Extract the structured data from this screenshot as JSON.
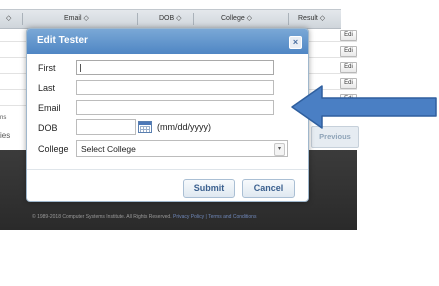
{
  "table": {
    "headers": [
      "◇",
      "Email ◇",
      "DOB ◇",
      "College ◇",
      "Result ◇"
    ],
    "edit_label": "Edi"
  },
  "side_fragments": [
    "ies",
    "ns"
  ],
  "pagination": {
    "previous_label": "Previous"
  },
  "footer": {
    "copyright": "© 1989-2018 Computer Systems Institute. All Rights Reserved.",
    "privacy": "Privacy Policy",
    "sep": " | ",
    "terms": "Terms and Conditions"
  },
  "modal": {
    "title": "Edit Tester",
    "close_symbol": "×",
    "fields": {
      "first_label": "First",
      "last_label": "Last",
      "email_label": "Email",
      "dob_label": "DOB",
      "dob_hint": "(mm/dd/yyyy)",
      "college_label": "College",
      "college_selected": "Select College"
    },
    "buttons": {
      "submit": "Submit",
      "cancel": "Cancel"
    }
  },
  "colors": {
    "modal_header": "#5a8fcb",
    "arrow_fill": "#4a7fc4",
    "arrow_stroke": "#2f5f9e"
  },
  "icons": {
    "calendar": "calendar-icon",
    "dropdown": "chevron-down-icon",
    "close": "close-icon"
  }
}
